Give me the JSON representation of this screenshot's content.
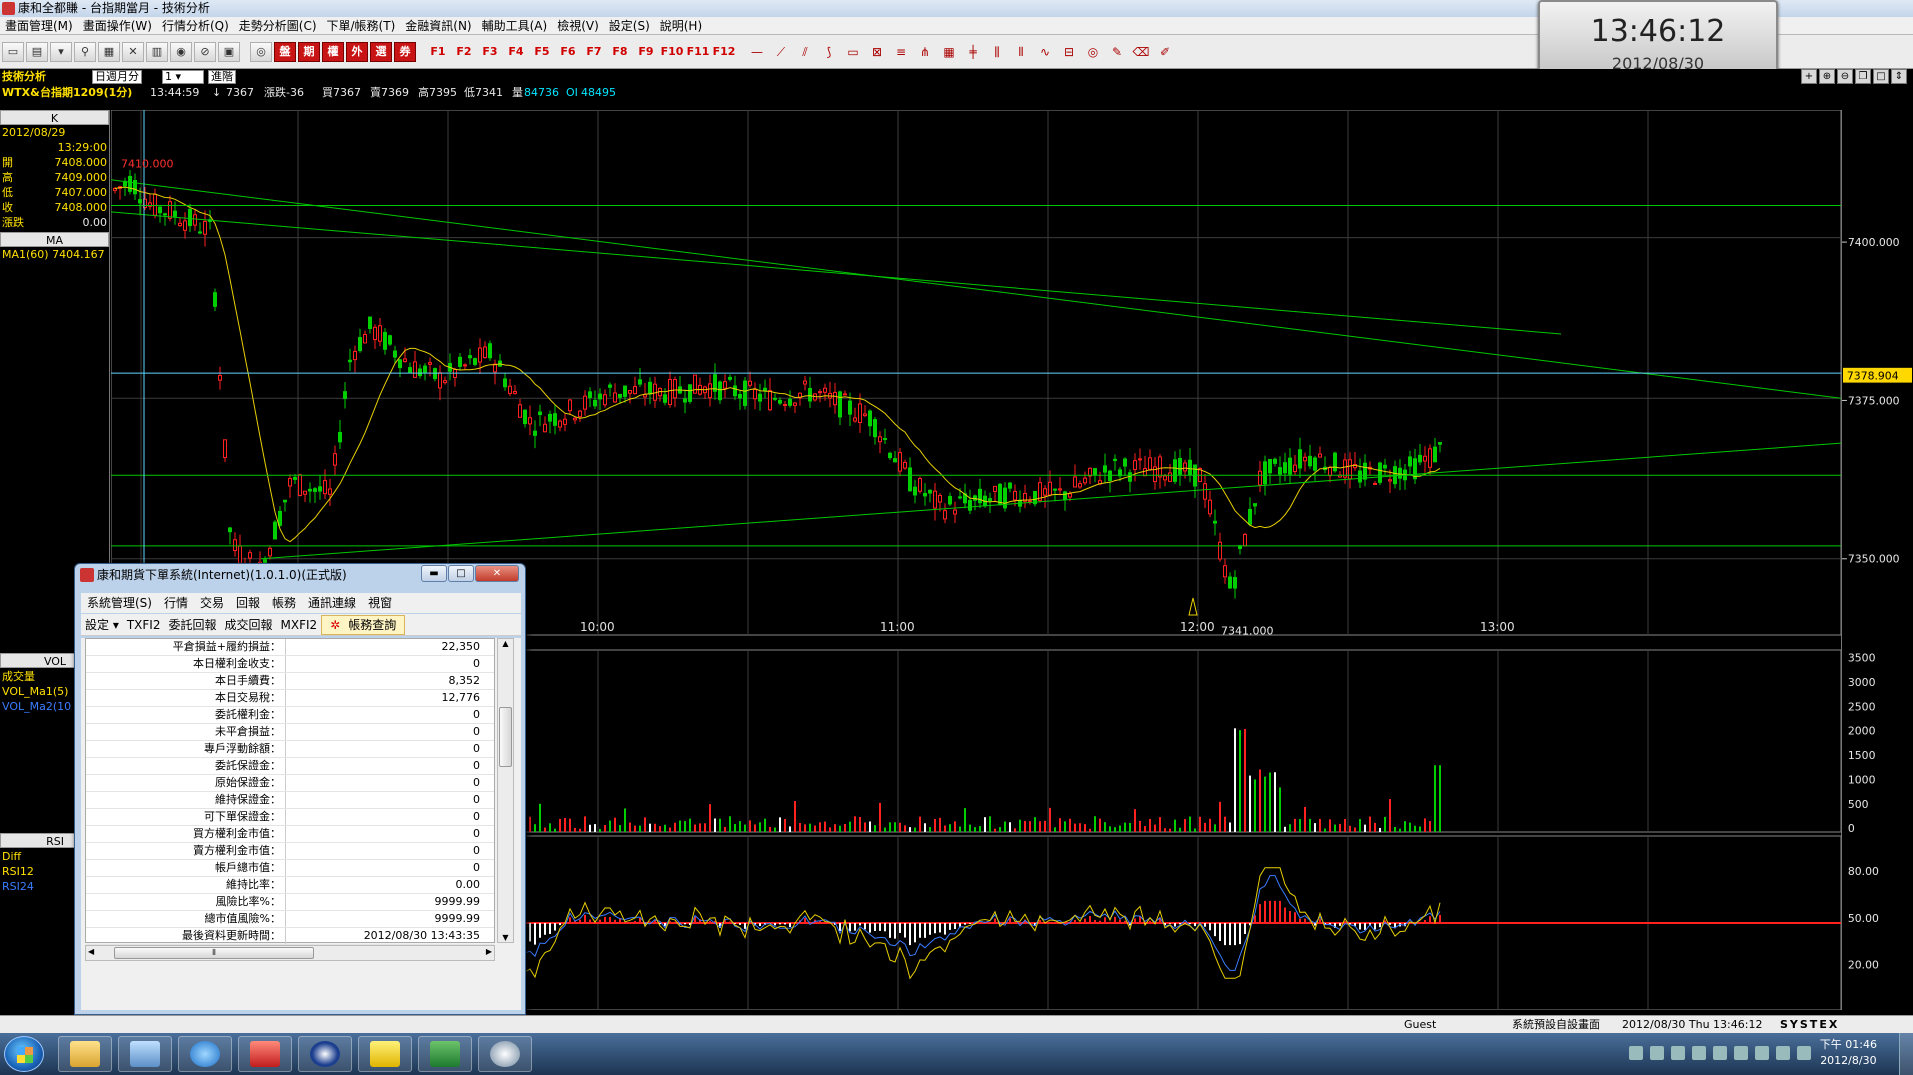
{
  "window": {
    "title": "康和全都賺 - 台指期當月 - 技術分析",
    "menu": [
      "畫面管理(M)",
      "畫面操作(W)",
      "行情分析(Q)",
      "走勢分析圖(C)",
      "下單/帳務(T)",
      "金融資訊(N)",
      "輔助工具(A)",
      "檢視(V)",
      "設定(S)",
      "說明(H)"
    ]
  },
  "toolbar": {
    "quote_buttons": [
      "盤",
      "期",
      "權",
      "外",
      "選",
      "券"
    ],
    "fkeys": [
      "F1",
      "F2",
      "F3",
      "F4",
      "F5",
      "F6",
      "F7",
      "F8",
      "F9",
      "F10",
      "F11",
      "F12"
    ]
  },
  "clock": {
    "time": "13:46:12",
    "date": "2012/08/30",
    "mark": "N"
  },
  "info": {
    "panel_title": "技術分析",
    "period": "日週月分",
    "period_value": "1",
    "advanced": "進階",
    "symbol": "WTX&",
    "contract": "台指期1209(1分)",
    "time": "13:44:59",
    "arrow": "↓",
    "price": "7367",
    "change": "漲跌-36",
    "bid": "買7367",
    "ask": "賣7369",
    "high": "高7395",
    "low": "低7341",
    "volume_label": "量",
    "volume": "84736",
    "oi_label": "OI",
    "oi": "48495"
  },
  "left_panel": {
    "k_header": "K",
    "date": "2012/08/29",
    "time": "13:29:00",
    "rows": [
      {
        "label": "開",
        "value": "7408.000"
      },
      {
        "label": "高",
        "value": "7409.000"
      },
      {
        "label": "低",
        "value": "7407.000"
      },
      {
        "label": "收",
        "value": "7408.000"
      },
      {
        "label": "漲跌",
        "value": "0.00"
      }
    ],
    "ma_header": "MA",
    "ma_value": "MA1(60) 7404.167",
    "vol_header": "VOL",
    "vol_rows": [
      "成交量",
      "VOL_Ma1(5)",
      "VOL_Ma2(10"
    ],
    "rsi_header": "RSI",
    "rsi_rows": [
      "Diff",
      "RSI12",
      "RSI24"
    ]
  },
  "chart_data": {
    "type": "candlestick",
    "price_axis_ticks": [
      "7400.000",
      "7375.000",
      "7350.000"
    ],
    "price_axis_values": [
      7400,
      7375,
      7350
    ],
    "price_range": [
      7340,
      7418
    ],
    "time_ticks": [
      "10:00",
      "11:00",
      "12:00",
      "13:00"
    ],
    "current_price_marker": "7378.904",
    "current_price_value": 7378.904,
    "annotations": [
      {
        "text": "7410.000",
        "value": 7410
      },
      {
        "text": "7341.000",
        "value": 7341
      }
    ],
    "volume_axis_ticks": [
      "3500",
      "3000",
      "2500",
      "2000",
      "1500",
      "1000",
      "500",
      "0"
    ],
    "volume_range": [
      0,
      3600
    ],
    "rsi_axis_ticks": [
      "80.00",
      "50.00",
      "20.00"
    ],
    "rsi_range": [
      0,
      100
    ],
    "grid": true
  },
  "status": {
    "user": "Guest",
    "layout": "系統預設自設畫面",
    "datetime": "2012/08/30 Thu 13:46:12",
    "brand": "SYSTEX"
  },
  "order_window": {
    "title": "康和期貨下單系統(Internet)(1.0.1.0)(正式版)",
    "menu": [
      "系統管理(S)",
      "行情",
      "交易",
      "回報",
      "帳務",
      "通訊連線",
      "視窗"
    ],
    "tools": [
      "設定 ▾",
      "TXFI2",
      "委託回報",
      "成交回報",
      "MXFI2",
      "帳務查詢"
    ],
    "rows": [
      {
        "k": "平倉損益+履約損益：",
        "v": "22,350"
      },
      {
        "k": "本日權利金收支：",
        "v": "0"
      },
      {
        "k": "本日手續費：",
        "v": "8,352"
      },
      {
        "k": "本日交易稅：",
        "v": "12,776"
      },
      {
        "k": "委託權利金：",
        "v": "0"
      },
      {
        "k": "未平倉損益：",
        "v": "0"
      },
      {
        "k": "專戶浮動餘額：",
        "v": "0"
      },
      {
        "k": "委託保證金：",
        "v": "0"
      },
      {
        "k": "原始保證金：",
        "v": "0"
      },
      {
        "k": "維持保證金：",
        "v": "0"
      },
      {
        "k": "可下單保證金：",
        "v": "0"
      },
      {
        "k": "買方權利金市值：",
        "v": "0"
      },
      {
        "k": "賣方權利金市值：",
        "v": "0"
      },
      {
        "k": "帳戶總市值：",
        "v": "0"
      },
      {
        "k": "維持比率：",
        "v": "0.00"
      },
      {
        "k": "風險比率%：",
        "v": "9999.99"
      },
      {
        "k": "總市值風險%：",
        "v": "9999.99"
      },
      {
        "k": "最後資料更新時間：",
        "v": "2012/08/30 13:43:35"
      }
    ]
  },
  "taskbar": {
    "clock_line1": "下午 01:46",
    "clock_line2": "2012/8/30"
  },
  "colors": {
    "up": "#ff2020",
    "down": "#00d000",
    "ma": "#e8d000",
    "rsi12": "#e8d000",
    "rsi24": "#3a7cff"
  }
}
